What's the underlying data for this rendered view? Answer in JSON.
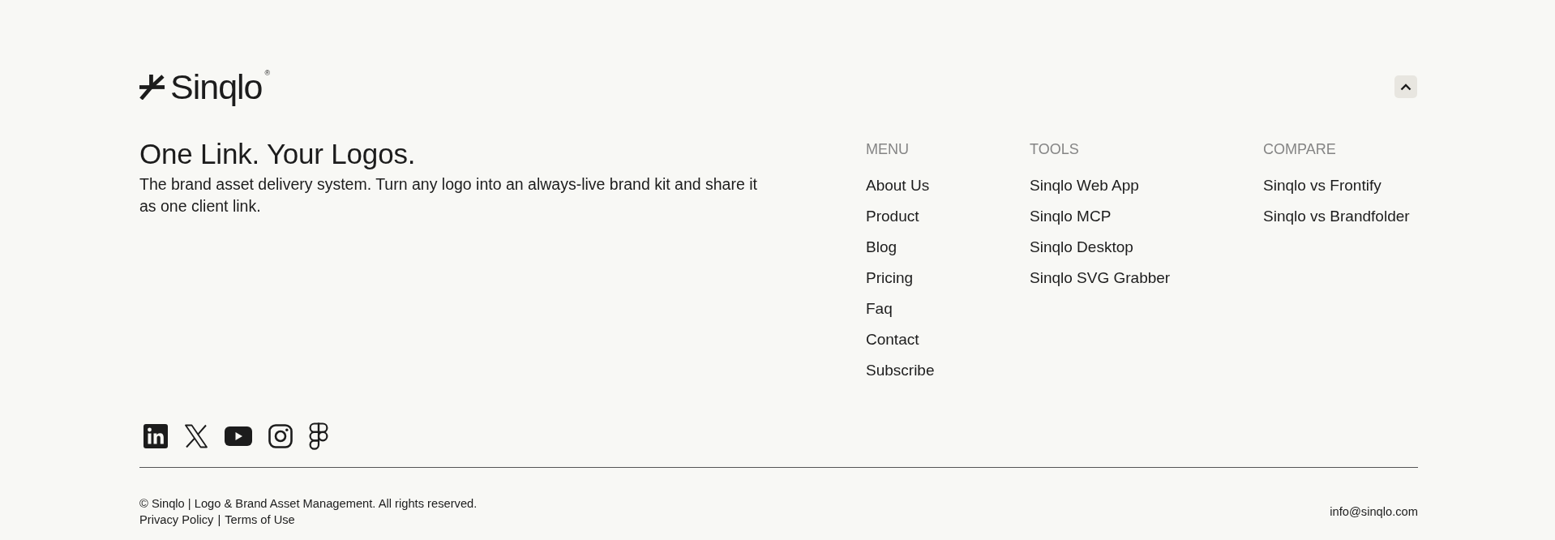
{
  "logo": {
    "text": "Sinqlo",
    "mark": "®"
  },
  "intro": {
    "headline": "One Link. Your Logos.",
    "description": "The brand asset delivery system. Turn any logo into an always-live brand kit and share it as one client link."
  },
  "columns": [
    {
      "heading": "MENU",
      "links": [
        "About Us",
        "Product",
        "Blog",
        "Pricing",
        "Faq",
        "Contact",
        "Subscribe"
      ]
    },
    {
      "heading": "TOOLS",
      "links": [
        "Sinqlo Web App",
        "Sinqlo MCP",
        "Sinqlo Desktop",
        "Sinqlo SVG Grabber"
      ]
    },
    {
      "heading": "COMPARE",
      "links": [
        "Sinqlo vs Frontify",
        "Sinqlo vs Brandfolder"
      ]
    }
  ],
  "bottom": {
    "copyright": "© Sinqlo | Logo & Brand Asset Management. All rights reserved.",
    "legal_links": [
      "Privacy Policy",
      "Terms of Use"
    ],
    "separator": "|",
    "email": "info@sinqlo.com"
  }
}
